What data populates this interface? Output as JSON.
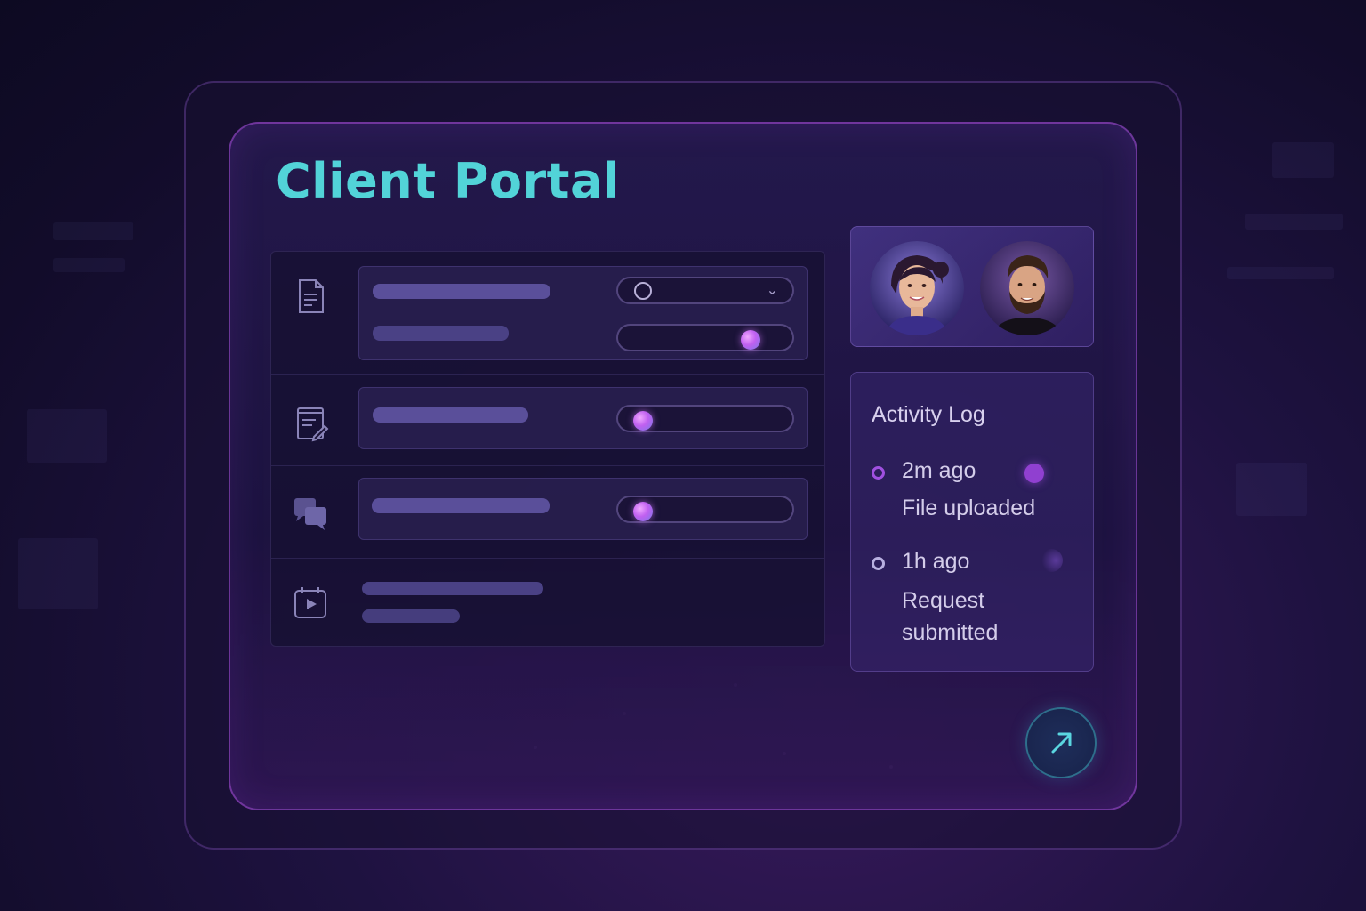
{
  "app": {
    "title": "Client Portal"
  },
  "list": {
    "rows": [
      {
        "icon": "document-icon"
      },
      {
        "icon": "edit-document-icon"
      },
      {
        "icon": "chat-bubbles-icon"
      },
      {
        "icon": "video-calendar-icon"
      }
    ]
  },
  "controls": {
    "row1_toggle_level": 0.85,
    "row2_toggle_level": 0.1,
    "row3_toggle_level": 0.1
  },
  "team": {
    "avatars": [
      "woman-avatar",
      "man-avatar"
    ]
  },
  "activity_log": {
    "title": "Activity Log",
    "entries": [
      {
        "time": "2m ago",
        "text": "File uploaded"
      },
      {
        "time": "1h ago",
        "text_line1": "Request",
        "text_line2": "submitted"
      }
    ]
  },
  "fab": {
    "icon": "arrow-up-right-icon"
  },
  "colors": {
    "accent": "#52d3d8",
    "purple": "#a050e0",
    "background": "#1e1240"
  }
}
